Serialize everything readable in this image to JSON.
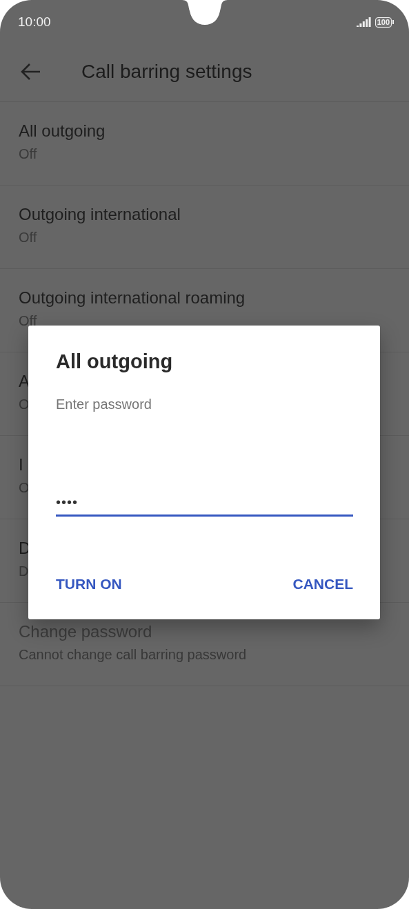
{
  "status_bar": {
    "time": "10:00",
    "battery": "100"
  },
  "toolbar": {
    "title": "Call barring settings"
  },
  "settings": [
    {
      "title": "All outgoing",
      "summary": "Off",
      "disabled": false
    },
    {
      "title": "Outgoing international",
      "summary": "Off",
      "disabled": false
    },
    {
      "title": "Outgoing international roaming",
      "summary": "Off",
      "disabled": false
    },
    {
      "title": "A",
      "summary": "O",
      "disabled": false
    },
    {
      "title": "I",
      "summary": "O",
      "disabled": false
    },
    {
      "title": "D",
      "summary": "D",
      "disabled": false
    },
    {
      "title": "Change password",
      "summary": "Cannot change call barring password",
      "disabled": true
    }
  ],
  "dialog": {
    "title": "All outgoing",
    "label": "Enter password",
    "value": "••••",
    "buttons": [
      "TURN ON",
      "CANCEL"
    ]
  }
}
